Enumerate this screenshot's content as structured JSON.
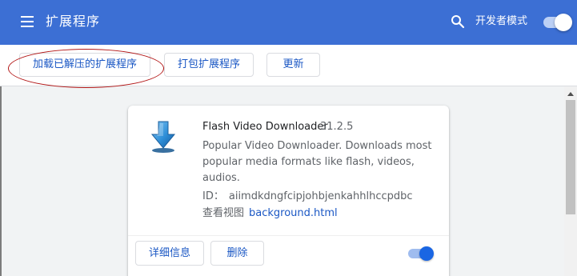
{
  "header": {
    "title": "扩展程序",
    "dev_mode_label": "开发者模式",
    "dev_mode_enabled": true,
    "menu_icon": "hamburger-menu-icon",
    "search_icon": "search-icon"
  },
  "toolbar": {
    "load_unpacked_label": "加载已解压的扩展程序",
    "pack_label": "打包扩展程序",
    "update_label": "更新"
  },
  "extension": {
    "name": "Flash Video Downloader",
    "version": "31.2.5",
    "description": "Popular Video Downloader. Downloads most popular media formats like flash, videos, audios.",
    "id_label": "ID：",
    "id_value": "aiimdkdngfcipjohbjenkahhlhccpdbc",
    "view_label": "查看视图",
    "view_link": "background.html",
    "details_label": "详细信息",
    "remove_label": "删除",
    "enabled": true,
    "icon": "download-arrow-icon"
  },
  "colors": {
    "header_bg": "#3c6fd4",
    "accent": "#1a57c4",
    "annotation": "#b21616"
  }
}
